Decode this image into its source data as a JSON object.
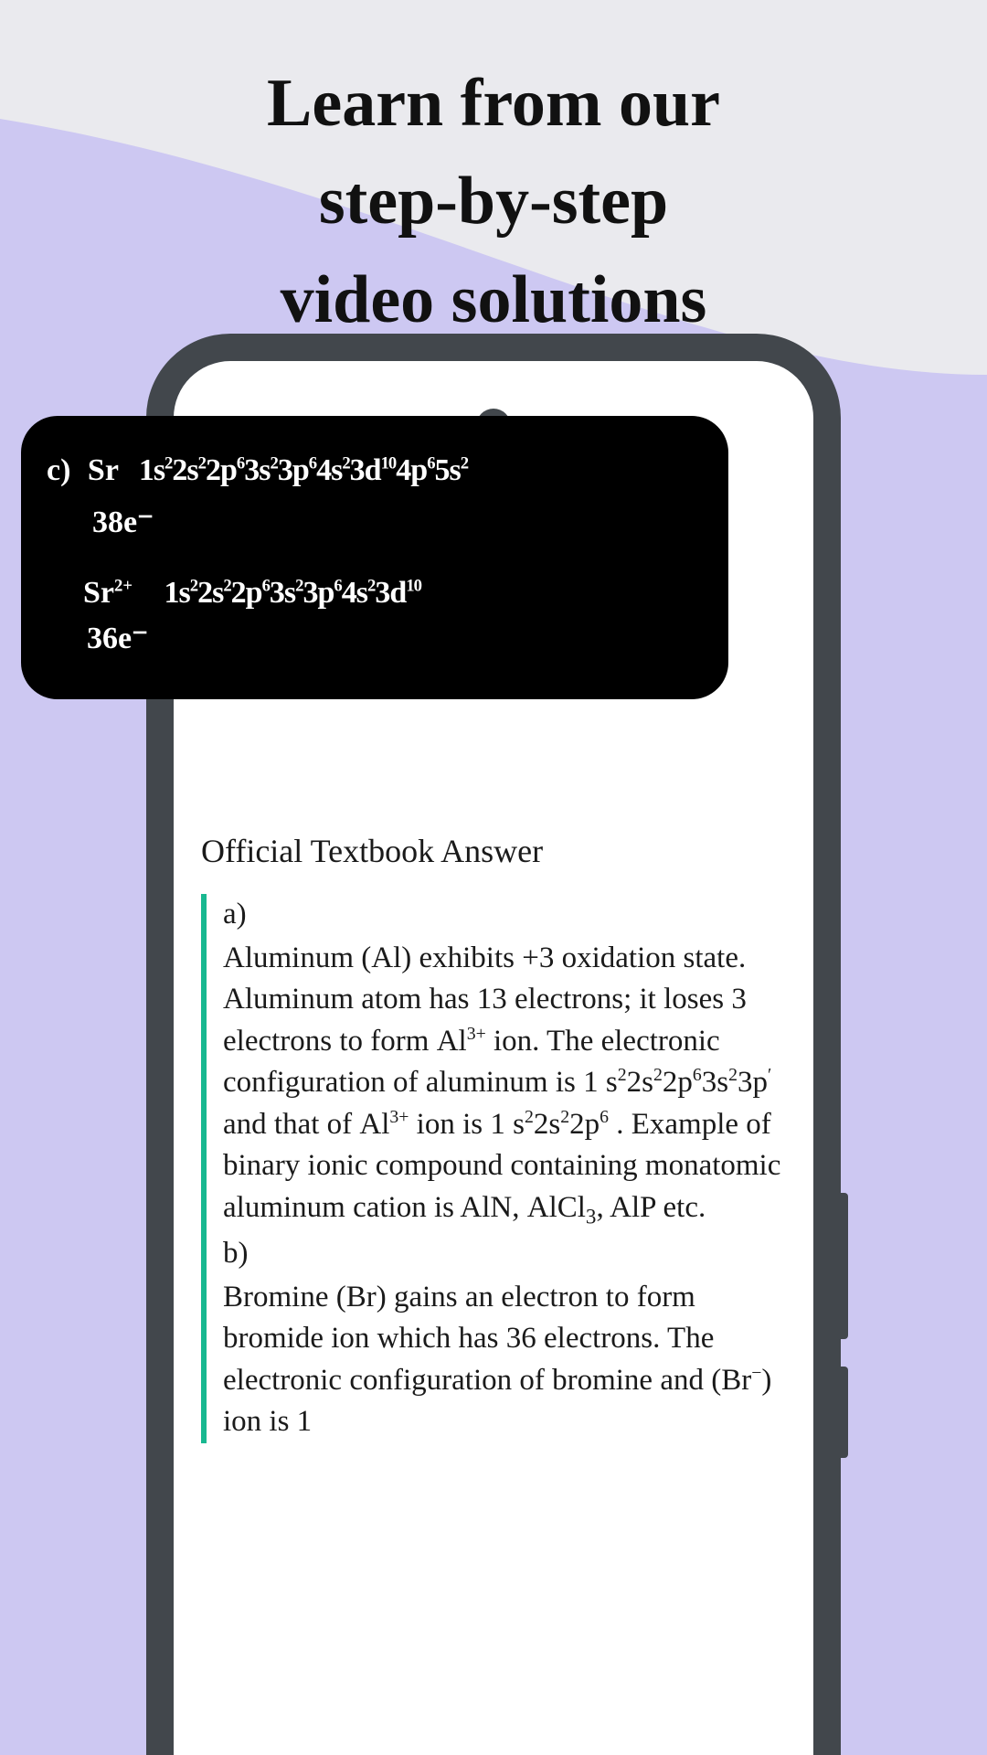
{
  "headline": {
    "line1": "Learn from our",
    "line2": "step-by-step",
    "line3": "video solutions"
  },
  "video": {
    "part_label": "c)",
    "element1": "Sr",
    "config1": "1s²2s²2p⁶3s²3p⁶4s²3d¹⁰4p⁶5s²",
    "electrons1": "38e⁻",
    "ion1": "Sr²⁺",
    "config2": "1s²2s²2p⁶3s²3p⁶4s²3d¹⁰",
    "electrons2": "36e⁻"
  },
  "textbook": {
    "title": "Official Textbook Answer",
    "a_label": "a)",
    "a_line1_pre": "Aluminum (Al) exhibits ",
    "a_ox": "+3",
    "a_line1_post": " oxidation state. Aluminum atom has 13 electrons; it loses 3 electrons to form ",
    "al3": "Al³⁺",
    "a_line2_mid": " ion. The electronic configuration of aluminum is 1 ",
    "al_config_neutral": "s²2s²2p⁶3s²3p′",
    "a_line2_mid2": " and that of ",
    "a_line2_mid3": " ion is 1 ",
    "al_config_ion": "s²2s²2p⁶",
    "a_line3_mid": " . Example of binary ionic compound containing monatomic aluminum cation is AlN, ",
    "alcl3": "AlCl₃",
    "a_line3_end": ", AlP etc.",
    "b_label": "b)",
    "b_body_pre": "Bromine (Br) gains an electron to form bromide ion which has 36 electrons. The electronic configuration of bromine and ",
    "br_ion": "(Br⁻)",
    "b_body_post": " ion is 1"
  }
}
